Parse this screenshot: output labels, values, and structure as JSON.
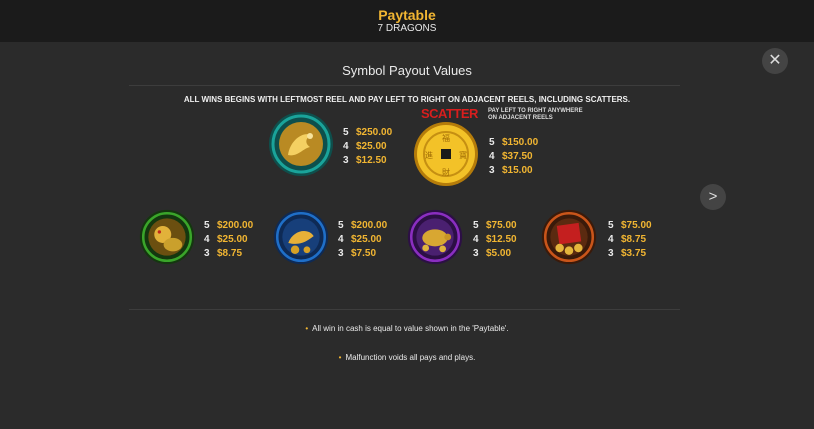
{
  "header": {
    "title": "Paytable",
    "subtitle": "7 DRAGONS"
  },
  "controls": {
    "close_glyph": "✕",
    "next_glyph": ">"
  },
  "section": {
    "title": "Symbol Payout Values",
    "rules": "ALL WINS BEGINS WITH LEFTMOST REEL AND PAY LEFT TO RIGHT ON ADJACENT REELS, INCLUDING SCATTERS."
  },
  "scatter": {
    "label": "SCATTER",
    "note_line1": "PAY LEFT TO RIGHT ANYWHERE",
    "note_line2": "ON ADJACENT REELS"
  },
  "symbols": [
    {
      "id": "dragon",
      "icon": "dragon-icon",
      "ring": "#1aa39a",
      "pays": [
        {
          "n": "5",
          "v": "$250.00"
        },
        {
          "n": "4",
          "v": "$25.00"
        },
        {
          "n": "3",
          "v": "$12.50"
        }
      ]
    },
    {
      "id": "coin",
      "icon": "coin-icon",
      "ring": "#d9a514",
      "pays": [
        {
          "n": "5",
          "v": "$150.00"
        },
        {
          "n": "4",
          "v": "$37.50"
        },
        {
          "n": "3",
          "v": "$15.00"
        }
      ]
    },
    {
      "id": "lion",
      "icon": "lion-icon",
      "ring": "#3aa52a",
      "pays": [
        {
          "n": "5",
          "v": "$200.00"
        },
        {
          "n": "4",
          "v": "$25.00"
        },
        {
          "n": "3",
          "v": "$8.75"
        }
      ]
    },
    {
      "id": "koi",
      "icon": "koi-icon",
      "ring": "#1f6fc8",
      "pays": [
        {
          "n": "5",
          "v": "$200.00"
        },
        {
          "n": "4",
          "v": "$25.00"
        },
        {
          "n": "3",
          "v": "$7.50"
        }
      ]
    },
    {
      "id": "turtle",
      "icon": "turtle-icon",
      "ring": "#8a2ec0",
      "pays": [
        {
          "n": "5",
          "v": "$75.00"
        },
        {
          "n": "4",
          "v": "$12.50"
        },
        {
          "n": "3",
          "v": "$5.00"
        }
      ]
    },
    {
      "id": "envelope",
      "icon": "red-envelope-icon",
      "ring": "#c9551a",
      "pays": [
        {
          "n": "5",
          "v": "$75.00"
        },
        {
          "n": "4",
          "v": "$8.75"
        },
        {
          "n": "3",
          "v": "$3.75"
        }
      ]
    }
  ],
  "notes": [
    "All win in cash is equal to value shown in the 'Paytable'.",
    "Malfunction voids all pays and plays."
  ],
  "colors": {
    "accent": "#f2b632",
    "background": "#2b2b2b",
    "header": "#1b1b1b"
  }
}
